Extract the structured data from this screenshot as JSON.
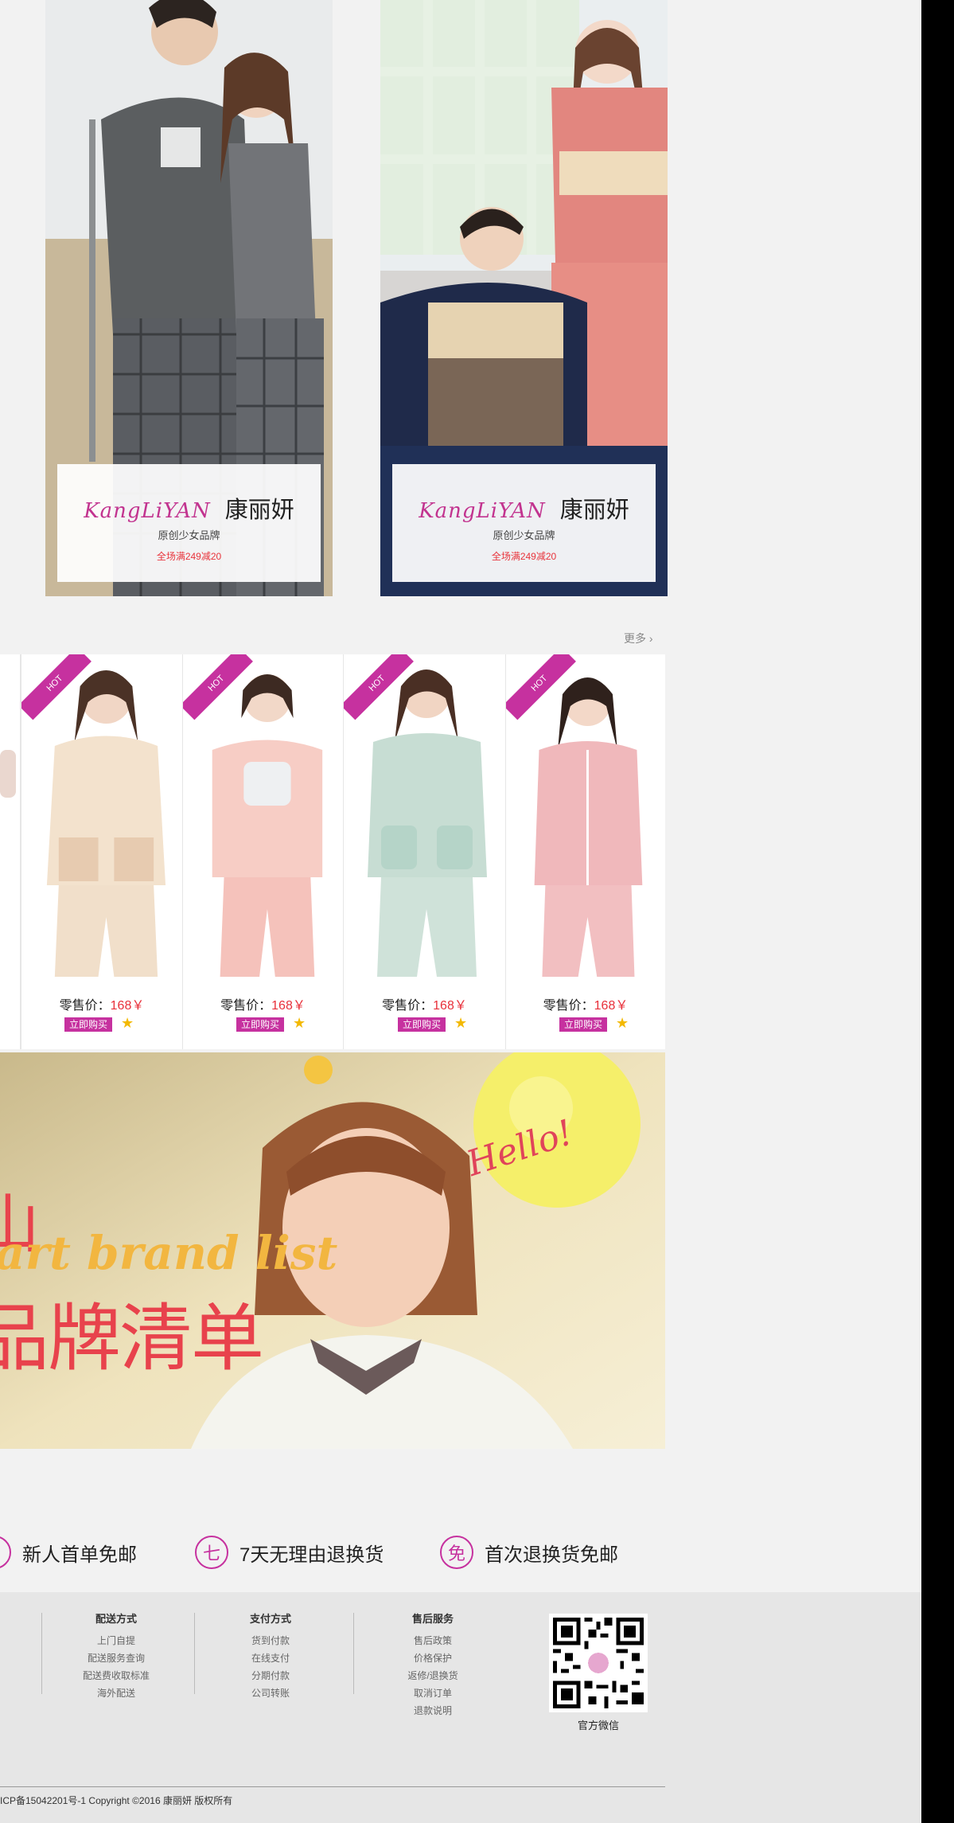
{
  "brands": [
    {
      "logo_en": "KangLiYAN",
      "logo_cn": "康丽妍",
      "subtitle": "原创少女品牌",
      "promo": "全场满249减20"
    },
    {
      "logo_en": "KangLiYAN",
      "logo_cn": "康丽妍",
      "subtitle": "原创少女品牌",
      "promo": "全场满249减20"
    }
  ],
  "products": {
    "more_label": "更多",
    "items": [
      {
        "hot": "HOT",
        "price_label": "零售价：",
        "price": "168￥",
        "buy_label": "立即购买"
      },
      {
        "hot": "HOT",
        "price_label": "零售价：",
        "price": "168￥",
        "buy_label": "立即购买"
      },
      {
        "hot": "HOT",
        "price_label": "零售价：",
        "price": "168￥",
        "buy_label": "立即购买"
      },
      {
        "hot": "HOT",
        "price_label": "零售价：",
        "price": "168￥",
        "buy_label": "立即购买"
      }
    ]
  },
  "banner": {
    "hello": "Hello!",
    "en_text": "art brand list",
    "cn_text": "品牌清单",
    "partial_char": "山"
  },
  "promises": [
    {
      "icon_char": "",
      "label": "新人首单免邮"
    },
    {
      "icon_char": "七",
      "label": "7天无理由退换货"
    },
    {
      "icon_char": "免",
      "label": "首次退换货免邮"
    }
  ],
  "footer": {
    "columns": [
      {
        "title": "配送方式",
        "links": [
          "上门自提",
          "配送服务查询",
          "配送费收取标准",
          "海外配送"
        ]
      },
      {
        "title": "支付方式",
        "links": [
          "货到付款",
          "在线支付",
          "分期付款",
          "公司转账"
        ]
      },
      {
        "title": "售后服务",
        "links": [
          "售后政策",
          "价格保护",
          "返修/退换货",
          "取消订单",
          "退款说明"
        ]
      }
    ],
    "qr_label": "官方微信",
    "copyright": "ICP备15042201号-1 Copyright ©2016 康丽妍 版权所有"
  },
  "colors": {
    "accent": "#c6319f",
    "price": "#e8303a",
    "star": "#f3b900"
  }
}
